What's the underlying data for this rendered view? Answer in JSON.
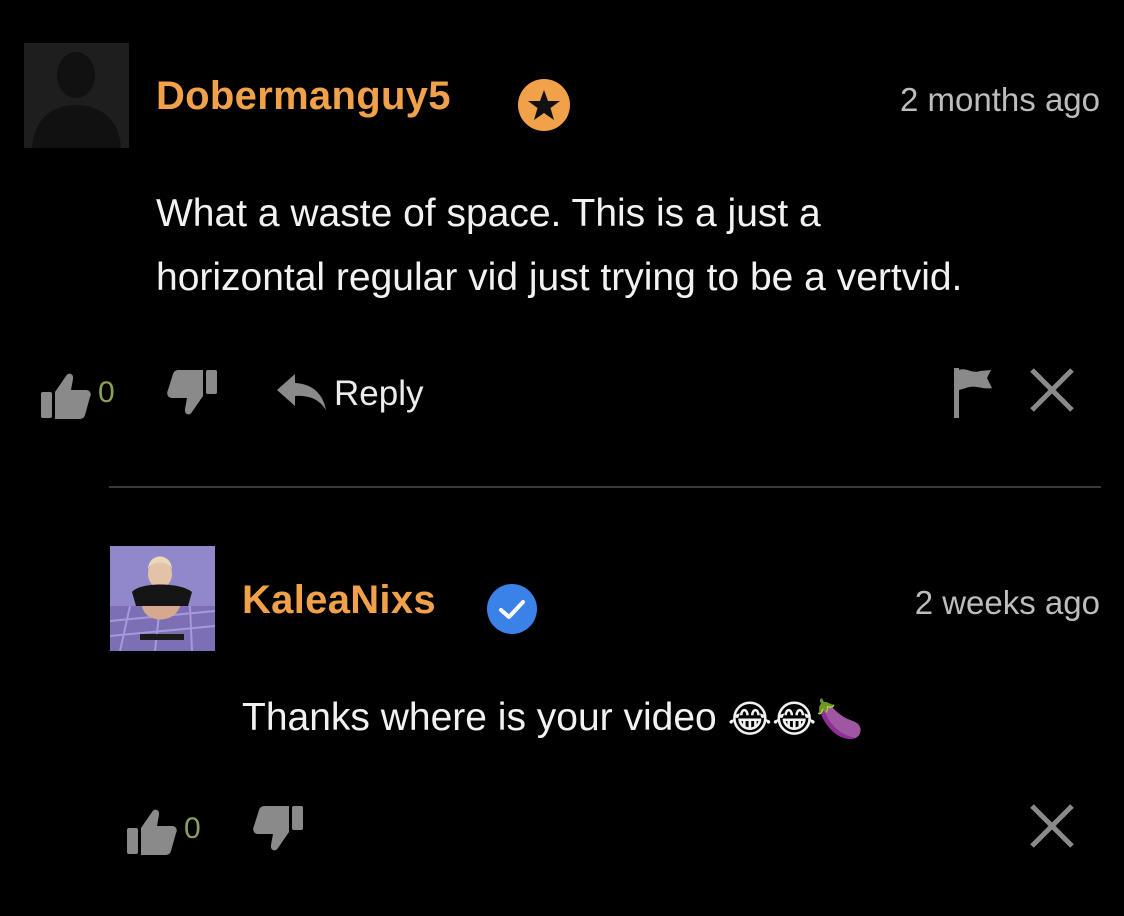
{
  "comments": [
    {
      "username": "Dobermanguy5",
      "badge_icon": "star-badge-icon",
      "timestamp": "2 months ago",
      "text_line1": "What a waste of space. This is a just a",
      "text_line2": "horizontal regular vid just trying to be a vertvid.",
      "likes": "0",
      "reply_label": "Reply"
    },
    {
      "username": "KaleaNixs",
      "badge_icon": "verified-check-icon",
      "timestamp": "2 weeks ago",
      "text": "Thanks where is your video",
      "emojis": [
        "😂",
        "😂",
        "🍆"
      ],
      "likes": "0"
    }
  ],
  "colors": {
    "background": "#000000",
    "username": "#f0a14a",
    "star_badge": "#f0a14a",
    "verified_badge": "#3b82e8",
    "count": "#8ba05a",
    "icon": "#8a8a8a"
  }
}
